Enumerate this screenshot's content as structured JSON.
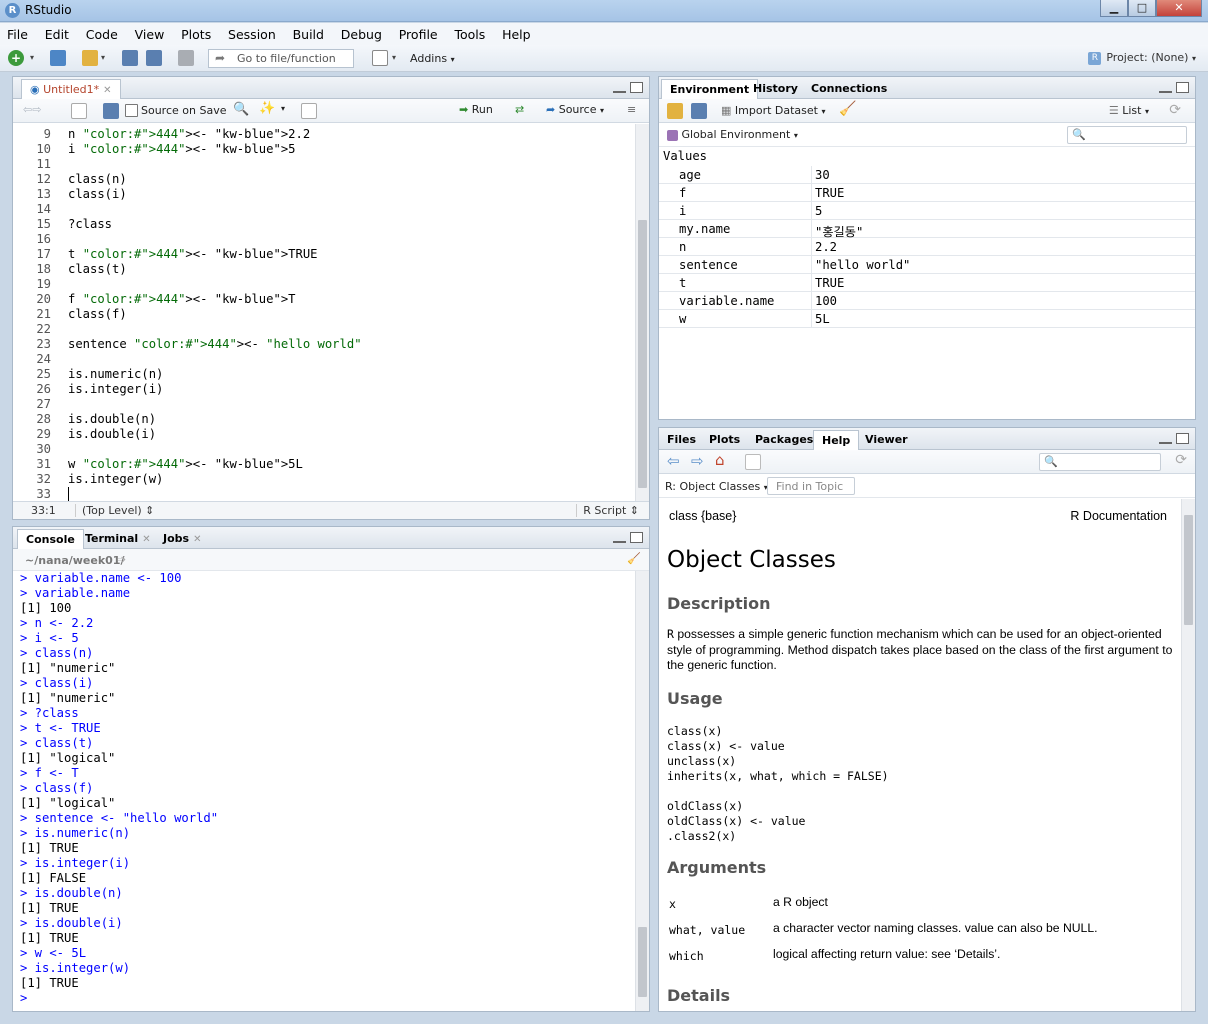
{
  "window": {
    "title": "RStudio"
  },
  "menu": [
    "File",
    "Edit",
    "Code",
    "View",
    "Plots",
    "Session",
    "Build",
    "Debug",
    "Profile",
    "Tools",
    "Help"
  ],
  "toolbar": {
    "goto_placeholder": "Go to file/function",
    "addins": "Addins",
    "project": "Project: (None)"
  },
  "editor": {
    "tab": "Untitled1*",
    "source_on_save": "Source on Save",
    "run": "Run",
    "source": "Source",
    "position": "33:1",
    "scope": "(Top Level)",
    "filetype": "R Script",
    "lines": [
      {
        "n": "9",
        "t": "n <- 2.2"
      },
      {
        "n": "10",
        "t": "i <- 5"
      },
      {
        "n": "11",
        "t": ""
      },
      {
        "n": "12",
        "t": "class(n)"
      },
      {
        "n": "13",
        "t": "class(i)"
      },
      {
        "n": "14",
        "t": ""
      },
      {
        "n": "15",
        "t": "?class"
      },
      {
        "n": "16",
        "t": ""
      },
      {
        "n": "17",
        "t": "t <- TRUE"
      },
      {
        "n": "18",
        "t": "class(t)"
      },
      {
        "n": "19",
        "t": ""
      },
      {
        "n": "20",
        "t": "f <- T"
      },
      {
        "n": "21",
        "t": "class(f)"
      },
      {
        "n": "22",
        "t": ""
      },
      {
        "n": "23",
        "t": "sentence <- \"hello world\""
      },
      {
        "n": "24",
        "t": ""
      },
      {
        "n": "25",
        "t": "is.numeric(n)"
      },
      {
        "n": "26",
        "t": "is.integer(i)"
      },
      {
        "n": "27",
        "t": ""
      },
      {
        "n": "28",
        "t": "is.double(n)"
      },
      {
        "n": "29",
        "t": "is.double(i)"
      },
      {
        "n": "30",
        "t": ""
      },
      {
        "n": "31",
        "t": "w <- 5L"
      },
      {
        "n": "32",
        "t": "is.integer(w)"
      },
      {
        "n": "33",
        "t": ""
      }
    ]
  },
  "console": {
    "tabs": [
      "Console",
      "Terminal",
      "Jobs"
    ],
    "path": "~/nana/week01/",
    "lines": [
      "> variable.name <- 100",
      "> variable.name",
      "[1] 100",
      "> n <- 2.2",
      "> i <- 5",
      "> class(n)",
      "[1] \"numeric\"",
      "> class(i)",
      "[1] \"numeric\"",
      "> ?class",
      "> t <- TRUE",
      "> class(t)",
      "[1] \"logical\"",
      "> f <- T",
      "> class(f)",
      "[1] \"logical\"",
      "> sentence <- \"hello world\"",
      "> is.numeric(n)",
      "[1] TRUE",
      "> is.integer(i)",
      "[1] FALSE",
      "> is.double(n)",
      "[1] TRUE",
      "> is.double(i)",
      "[1] TRUE",
      "> w <- 5L",
      "> is.integer(w)",
      "[1] TRUE",
      "> "
    ]
  },
  "environment": {
    "tabs": [
      "Environment",
      "History",
      "Connections"
    ],
    "import": "Import Dataset",
    "view": "List",
    "scope": "Global Environment",
    "section": "Values",
    "vars": [
      {
        "name": "age",
        "value": "30"
      },
      {
        "name": "f",
        "value": "TRUE"
      },
      {
        "name": "i",
        "value": "5"
      },
      {
        "name": "my.name",
        "value": "\"홍길동\""
      },
      {
        "name": "n",
        "value": "2.2"
      },
      {
        "name": "sentence",
        "value": "\"hello world\""
      },
      {
        "name": "t",
        "value": "TRUE"
      },
      {
        "name": "variable.name",
        "value": "100"
      },
      {
        "name": "w",
        "value": "5L"
      }
    ]
  },
  "help": {
    "tabs": [
      "Files",
      "Plots",
      "Packages",
      "Help",
      "Viewer"
    ],
    "topic": "R: Object Classes",
    "find_placeholder": "Find in Topic",
    "header_left": "class {base}",
    "header_right": "R Documentation",
    "title": "Object Classes",
    "description_h": "Description",
    "description_r": "R",
    "description": " possesses a simple generic function mechanism which can be used for an object-oriented style of programming. Method dispatch takes place based on the class of the first argument to the generic function.",
    "usage_h": "Usage",
    "usage": "class(x)\nclass(x) <- value\nunclass(x)\ninherits(x, what, which = FALSE)\n\noldClass(x)\noldClass(x) <- value\n.class2(x)",
    "arguments_h": "Arguments",
    "args": [
      {
        "name": "x",
        "desc": "a R object"
      },
      {
        "name": "what, value",
        "desc": "a character vector naming classes. value can also be NULL."
      },
      {
        "name": "which",
        "desc": "logical affecting return value: see ‘Details’."
      }
    ],
    "details_h": "Details"
  },
  "colors": {
    "accent": "#2a6fb8",
    "code_blue": "#0000ff",
    "code_green": "#036a07"
  }
}
